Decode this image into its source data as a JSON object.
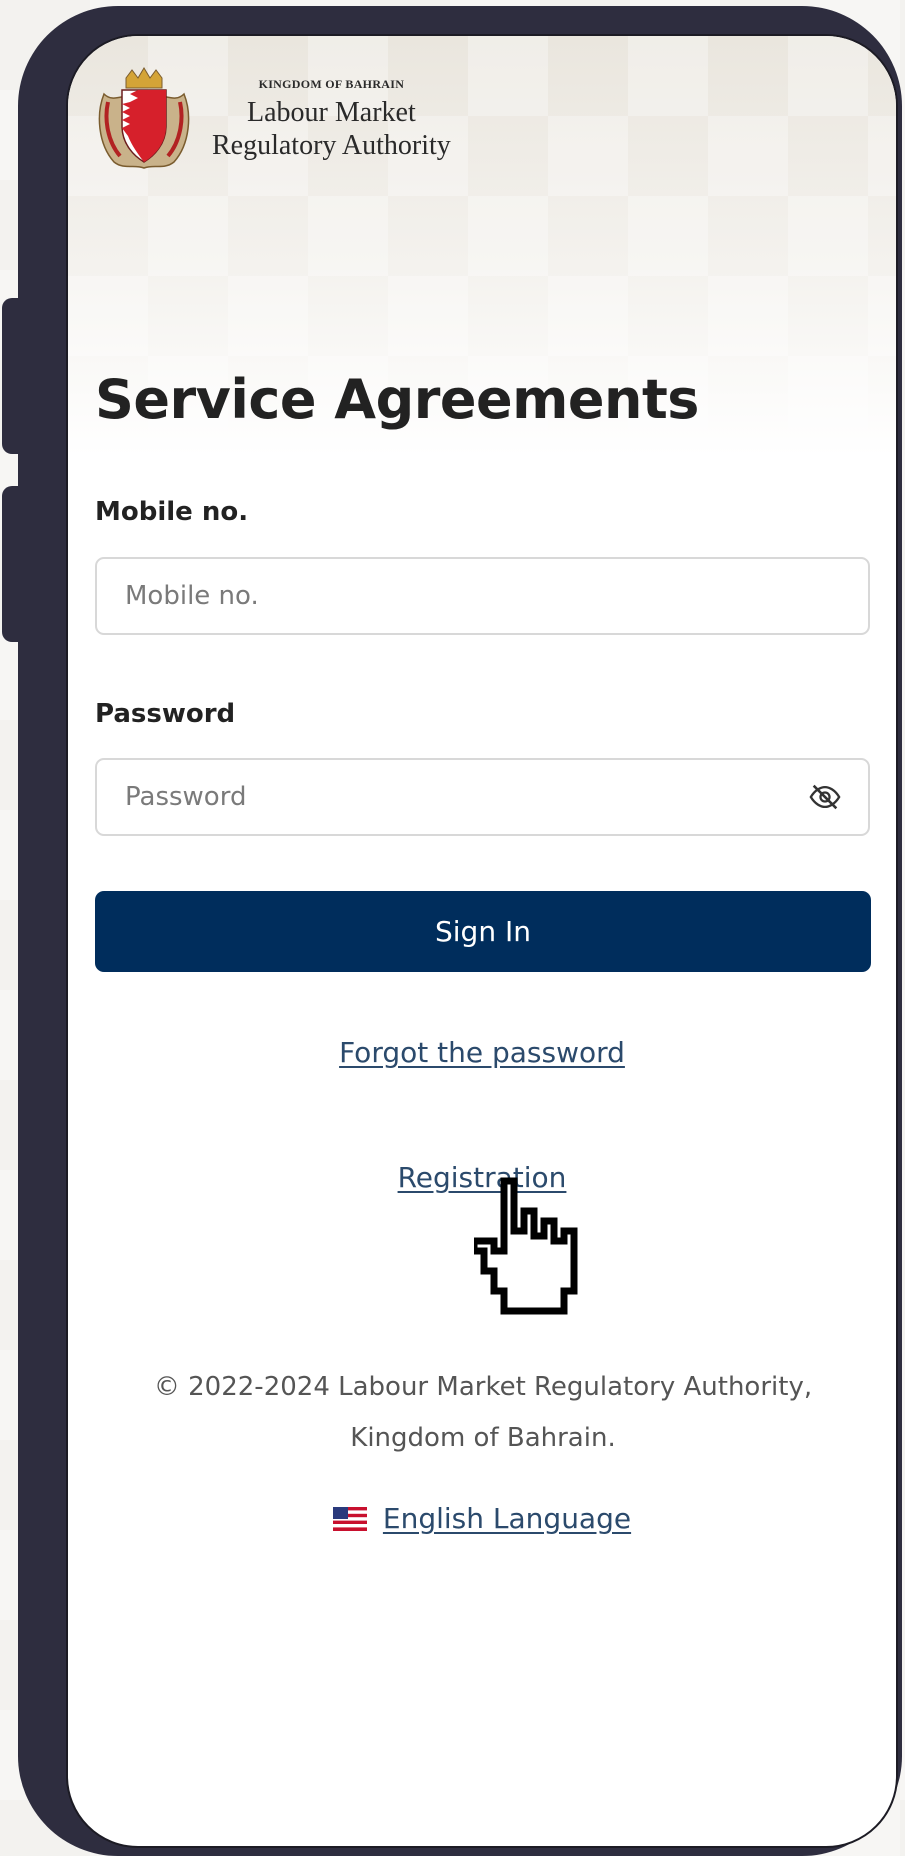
{
  "header": {
    "kingdom": "KINGDOM OF BAHRAIN",
    "org_line1": "Labour Market",
    "org_line2": "Regulatory Authority"
  },
  "page": {
    "title": "Service Agreements"
  },
  "form": {
    "mobile_label": "Mobile no.",
    "mobile_placeholder": "Mobile no.",
    "password_label": "Password",
    "password_placeholder": "Password",
    "sign_in_label": "Sign In"
  },
  "links": {
    "forgot": "Forgot the password",
    "registration": "Registration"
  },
  "footer": {
    "copyright_line1": "© 2022-2024 Labour Market Regulatory Authority,",
    "copyright_line2": "Kingdom of Bahrain.",
    "language": "English Language"
  },
  "icons": {
    "emblem": "bahrain-emblem-icon",
    "password_toggle": "eye-slash-icon",
    "flag": "us-flag-icon",
    "cursor": "hand-pointer-icon"
  },
  "colors": {
    "primary": "#002d5c",
    "link": "#2b4a6c",
    "frame": "#2e2d3f"
  }
}
